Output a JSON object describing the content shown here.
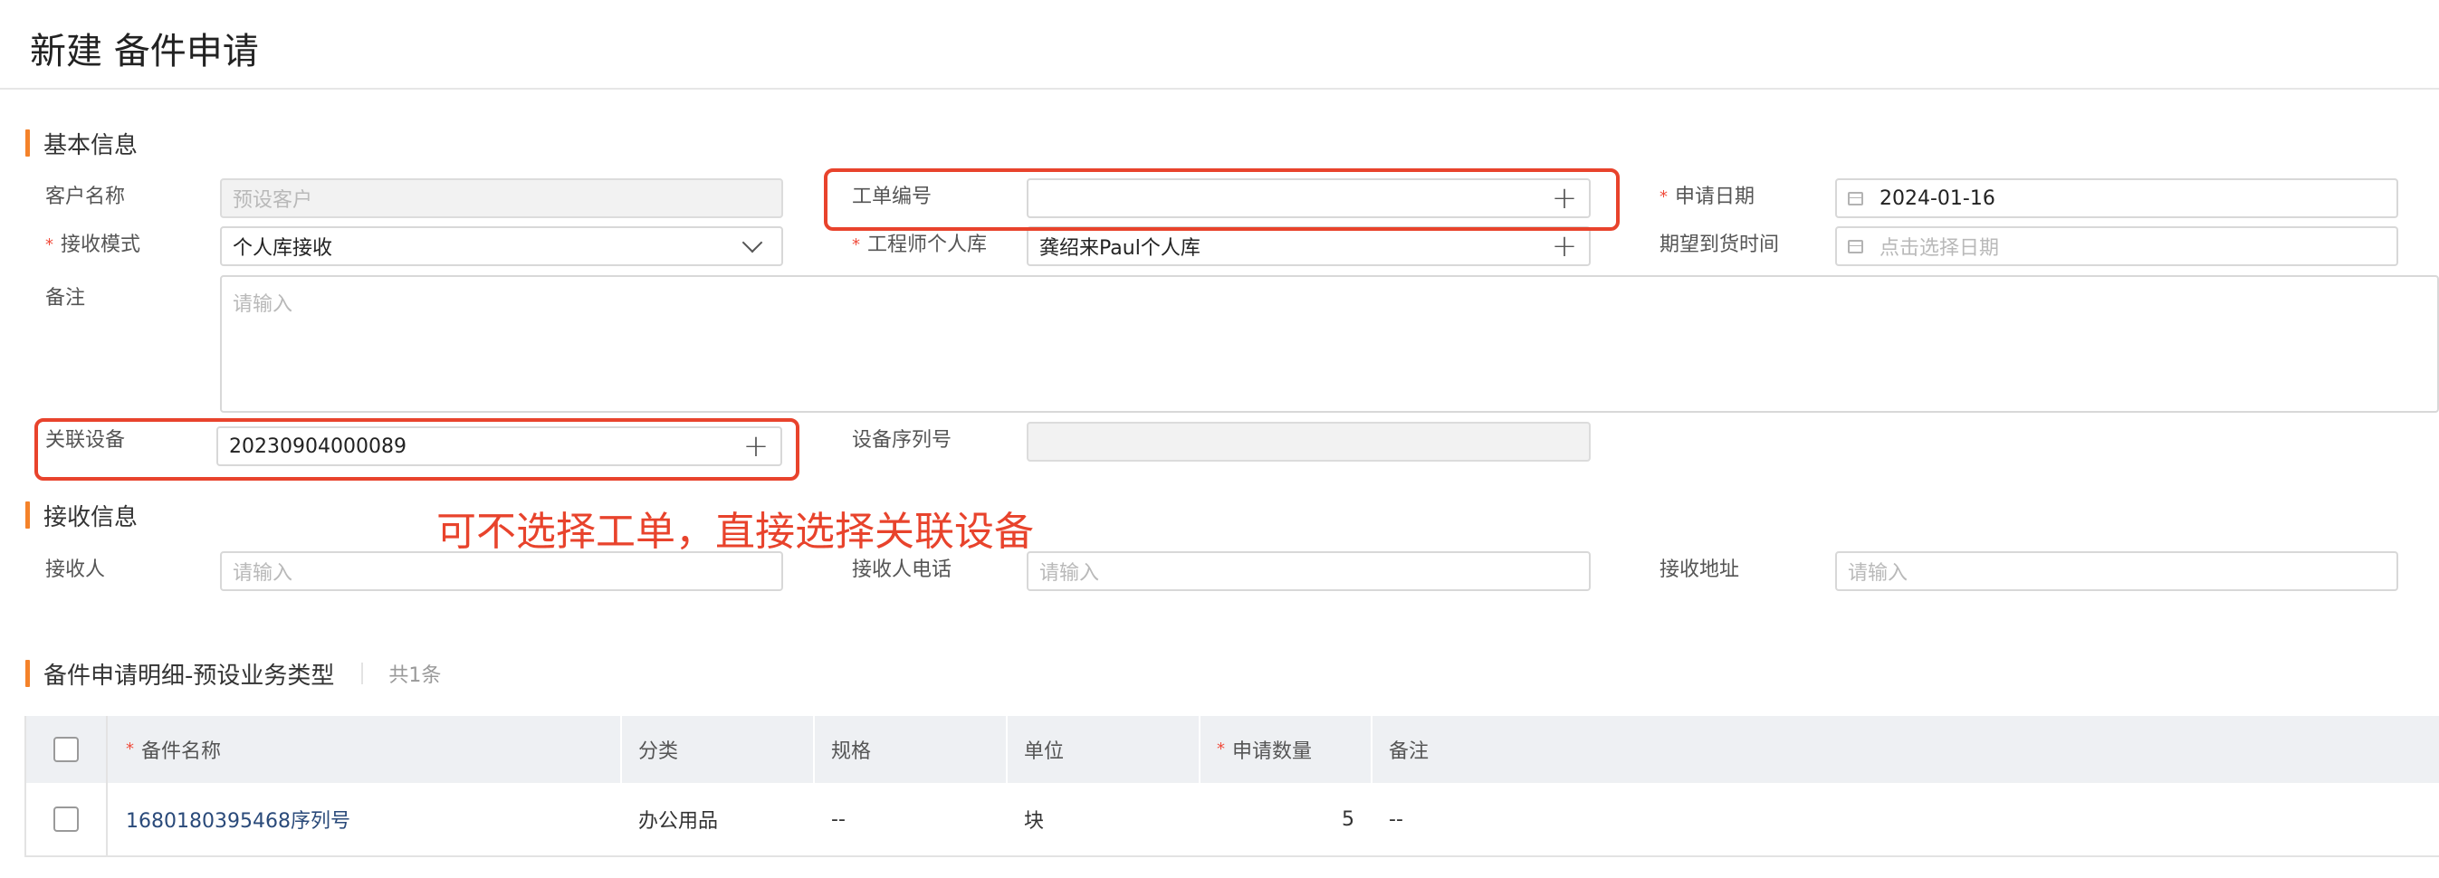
{
  "page": {
    "title": "新建 备件申请"
  },
  "sections": {
    "basic": "基本信息",
    "receive": "接收信息",
    "detail": "备件申请明细-预设业务类型",
    "detail_count": "共1条"
  },
  "basic": {
    "customer_name": {
      "label": "客户名称",
      "placeholder": "预设客户"
    },
    "work_order": {
      "label": "工单编号",
      "value": ""
    },
    "apply_date": {
      "label": "申请日期",
      "value": "2024-01-16"
    },
    "receive_mode": {
      "label": "接收模式",
      "value": "个人库接收"
    },
    "engineer_store": {
      "label": "工程师个人库",
      "value": "龚绍来Paul个人库"
    },
    "expected_time": {
      "label": "期望到货时间",
      "placeholder": "点击选择日期"
    },
    "remark": {
      "label": "备注",
      "placeholder": "请输入"
    },
    "device": {
      "label": "关联设备",
      "value": "20230904000089"
    },
    "serial": {
      "label": "设备序列号",
      "value": ""
    }
  },
  "annotation": "可不选择工单，直接选择关联设备",
  "receive": {
    "receiver": {
      "label": "接收人",
      "placeholder": "请输入"
    },
    "phone": {
      "label": "接收人电话",
      "placeholder": "请输入"
    },
    "address": {
      "label": "接收地址",
      "placeholder": "请输入"
    }
  },
  "table": {
    "headers": [
      "备件名称",
      "分类",
      "规格",
      "单位",
      "申请数量",
      "备注"
    ],
    "rows": [
      {
        "name": "1680180395468序列号",
        "category": "办公用品",
        "spec": "--",
        "unit": "块",
        "qty": "5",
        "remark": "--"
      }
    ]
  },
  "colors": {
    "accent": "#f4822a",
    "required": "#f04c3c",
    "annotation": "#e8432c"
  }
}
